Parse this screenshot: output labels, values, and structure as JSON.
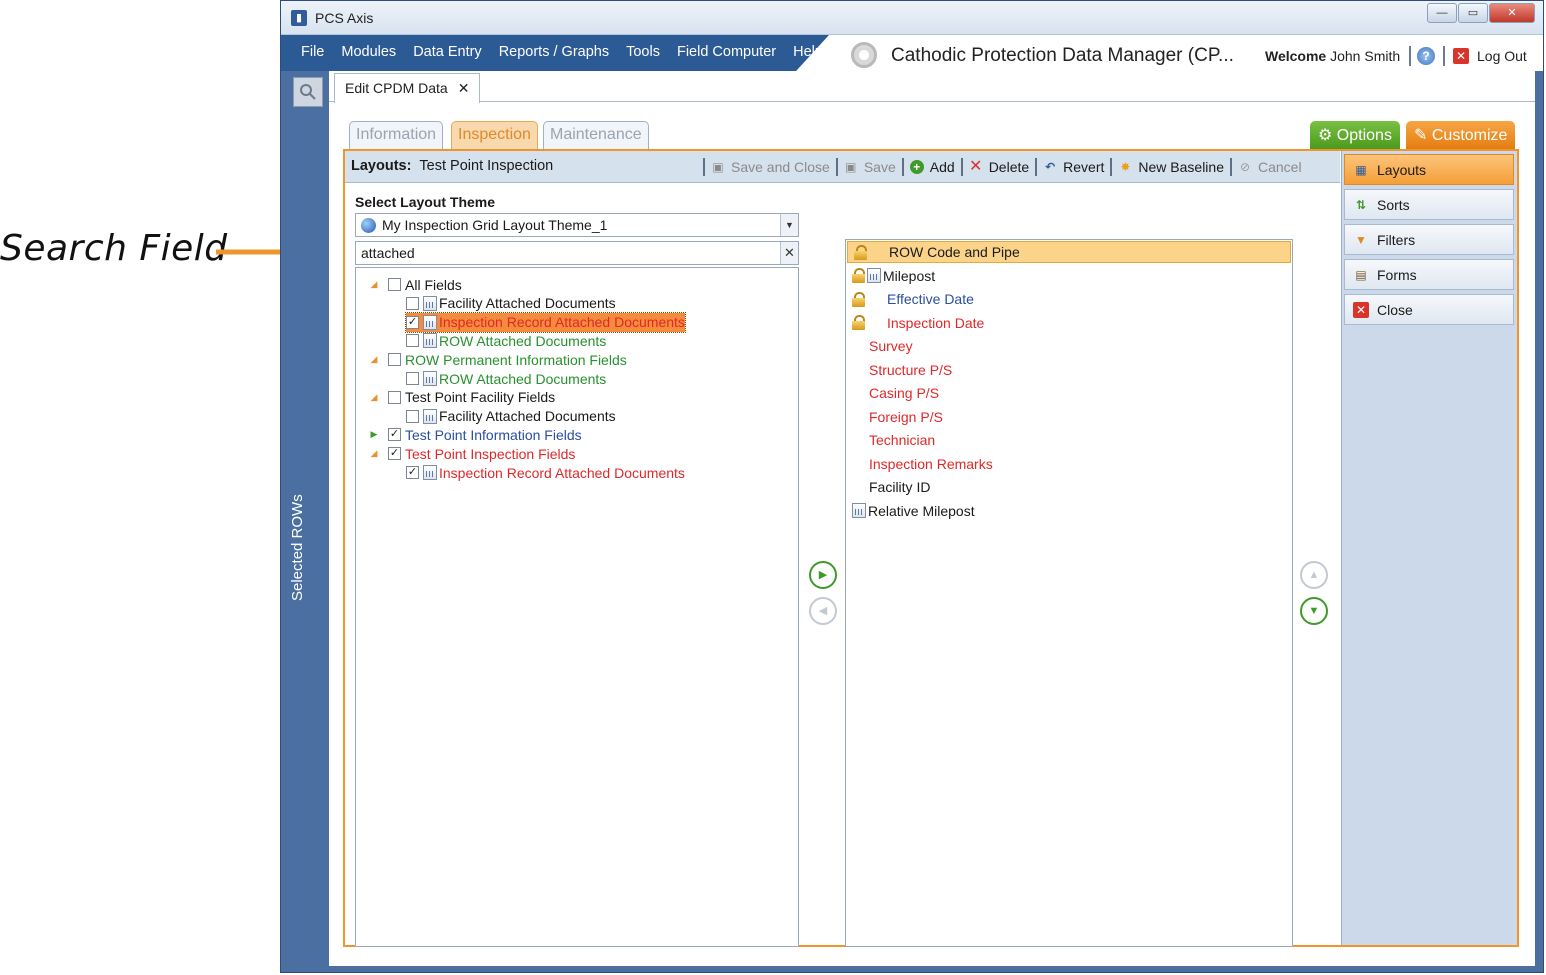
{
  "annotation": {
    "label": "Search Field"
  },
  "window": {
    "title": "PCS Axis",
    "controls": {
      "minimize": "—",
      "maximize": "▭",
      "close": "✕"
    }
  },
  "menu": {
    "items": [
      "File",
      "Modules",
      "Data Entry",
      "Reports / Graphs",
      "Tools",
      "Field Computer",
      "Help"
    ],
    "app_title": "Cathodic Protection Data Manager (CP...",
    "welcome_prefix": "Welcome",
    "user": "John Smith",
    "logout": "Log Out"
  },
  "left_strip": {
    "label": "Selected ROWs"
  },
  "doc_tab": {
    "label": "Edit CPDM Data",
    "close": "✕"
  },
  "sub_tabs": [
    "Information",
    "Inspection",
    "Maintenance"
  ],
  "options_label": "Options",
  "customize_label": "Customize",
  "layouts_bar": {
    "label": "Layouts:",
    "value": "Test Point Inspection",
    "toolbar": {
      "save_close": "Save and Close",
      "save": "Save",
      "add": "Add",
      "delete": "Delete",
      "revert": "Revert",
      "new_baseline": "New Baseline",
      "cancel": "Cancel"
    }
  },
  "theme": {
    "label": "Select Layout Theme",
    "value": "My Inspection Grid Layout Theme_1"
  },
  "search": {
    "value": "attached"
  },
  "tree": [
    {
      "label": "All Fields",
      "level": 0,
      "expanded": true,
      "checked": false,
      "color": "black"
    },
    {
      "label": "Facility Attached Documents",
      "level": 1,
      "checked": false,
      "color": "black"
    },
    {
      "label": "Inspection Record Attached Documents",
      "level": 1,
      "checked": true,
      "color": "red",
      "highlighted": true
    },
    {
      "label": "ROW Attached Documents",
      "level": 1,
      "checked": false,
      "color": "green"
    },
    {
      "label": "ROW Permanent Information Fields",
      "level": 0,
      "expanded": true,
      "checked": false,
      "color": "green"
    },
    {
      "label": "ROW Attached Documents",
      "level": 1,
      "checked": false,
      "color": "green"
    },
    {
      "label": "Test Point Facility Fields",
      "level": 0,
      "expanded": true,
      "checked": false,
      "color": "black"
    },
    {
      "label": "Facility Attached Documents",
      "level": 1,
      "checked": false,
      "color": "black"
    },
    {
      "label": "Test Point Information Fields",
      "level": 0,
      "expanded": false,
      "checked": true,
      "color": "blue"
    },
    {
      "label": "Test Point Inspection Fields",
      "level": 0,
      "expanded": true,
      "checked": true,
      "color": "red"
    },
    {
      "label": "Inspection Record Attached Documents",
      "level": 1,
      "checked": true,
      "color": "red"
    }
  ],
  "selected_fields": [
    {
      "label": "ROW Code and Pipe",
      "locked": true,
      "grid": false,
      "color": "black",
      "highlighted": true
    },
    {
      "label": "Milepost",
      "locked": true,
      "grid": true,
      "color": "black"
    },
    {
      "label": "Effective Date",
      "locked": true,
      "grid": false,
      "color": "blue"
    },
    {
      "label": "Inspection Date",
      "locked": true,
      "grid": false,
      "color": "red"
    },
    {
      "label": "Survey",
      "color": "red"
    },
    {
      "label": "Structure P/S",
      "color": "red"
    },
    {
      "label": "Casing P/S",
      "color": "red"
    },
    {
      "label": "Foreign P/S",
      "color": "red"
    },
    {
      "label": "Technician",
      "color": "red"
    },
    {
      "label": "Inspection Remarks",
      "color": "red"
    },
    {
      "label": "Facility ID",
      "color": "black"
    },
    {
      "label": "Relative Milepost",
      "grid": true,
      "color": "black"
    }
  ],
  "side_panel": {
    "layouts": "Layouts",
    "sorts": "Sorts",
    "filters": "Filters",
    "forms": "Forms",
    "close": "Close"
  },
  "colors": {
    "accent_orange": "#f0952b",
    "menu_blue": "#2c5a94",
    "frame_blue": "#4a6fa0",
    "field_red": "#e0282a",
    "field_green": "#27912e",
    "field_blue": "#2a4ea0"
  }
}
